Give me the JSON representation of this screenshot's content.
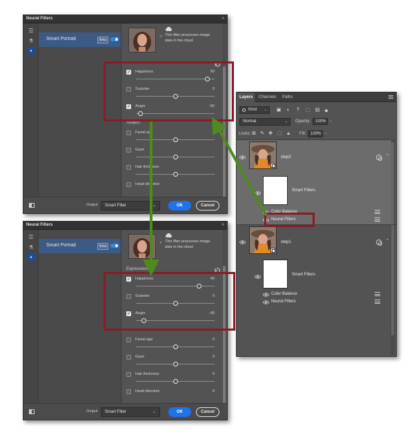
{
  "neural_filters": {
    "title": "Neural Filters",
    "filter_name": "Smart Portrait",
    "badge": "Beta",
    "cloud_notice": "This filter processes image data in the cloud.",
    "output_label": "Output",
    "output_value": "Smart Filter",
    "ok_label": "OK",
    "cancel_label": "Cancel"
  },
  "panel_top": {
    "sliders": [
      {
        "label": "Happiness",
        "value": "50",
        "checked": true,
        "level": 0.9
      },
      {
        "label": "Surprise",
        "value": "0",
        "checked": false,
        "level": 0.5
      },
      {
        "label": "Anger",
        "value": "-50",
        "checked": true,
        "level": 0.05
      }
    ],
    "section_subject": "Subject",
    "subject_sliders": [
      {
        "label": "Facial age",
        "value": "0",
        "checked": false,
        "level": 0.5
      },
      {
        "label": "Gaze",
        "value": "",
        "checked": false,
        "level": 0.5
      },
      {
        "label": "Hair thickness",
        "value": "",
        "checked": false,
        "level": 0.5
      },
      {
        "label": "Head direction",
        "value": "",
        "checked": false,
        "level": 0.5
      }
    ]
  },
  "panel_bottom": {
    "section_expressions": "Expressions",
    "sliders": [
      {
        "label": "Happiness",
        "value": "40",
        "checked": true,
        "level": 0.8
      },
      {
        "label": "Surprise",
        "value": "0",
        "checked": false,
        "level": 0.5
      },
      {
        "label": "Anger",
        "value": "-40",
        "checked": true,
        "level": 0.1
      }
    ],
    "subject_sliders": [
      {
        "label": "Facial age",
        "value": "0",
        "checked": false,
        "level": 0.5
      },
      {
        "label": "Gaze",
        "value": "0",
        "checked": false,
        "level": 0.5
      },
      {
        "label": "Hair thickness",
        "value": "0",
        "checked": false,
        "level": 0.5
      },
      {
        "label": "Head direction",
        "value": "0",
        "checked": false,
        "level": 0.5
      }
    ]
  },
  "layers_panel": {
    "tabs": [
      "Layers",
      "Channels",
      "Paths"
    ],
    "kind_label": "Kind",
    "blend_mode": "Normal",
    "opacity_label": "Opacity:",
    "opacity_value": "100%",
    "lock_label": "Locks:",
    "fill_label": "Fill:",
    "fill_value": "100%",
    "layers": [
      {
        "name": "step2",
        "smart_filters_label": "Smart Filters",
        "filters": [
          "Color Balance",
          "Neural Filters"
        ]
      },
      {
        "name": "step1",
        "smart_filters_label": "Smart Filters",
        "filters": [
          "Color Balance",
          "Neural Filters"
        ]
      }
    ]
  },
  "colors": {
    "highlight": "#8a1b24",
    "arrow": "#4f8a1e",
    "accent": "#1f73e8"
  }
}
